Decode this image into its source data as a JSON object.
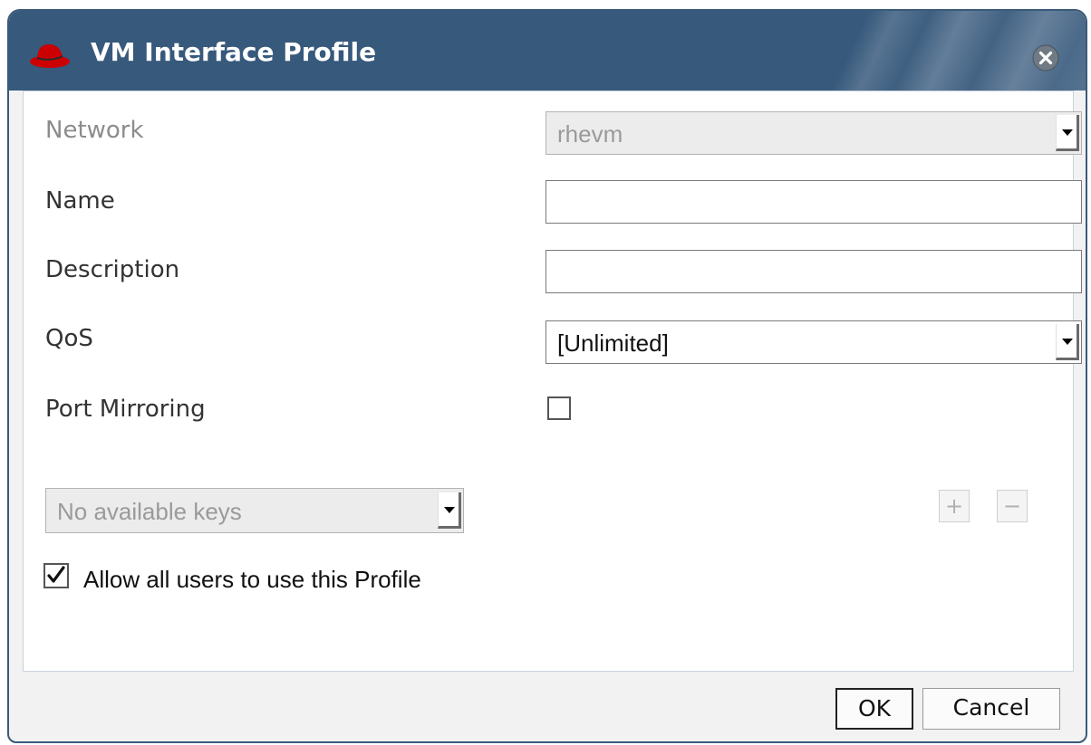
{
  "dialog": {
    "title": "VM Interface Profile",
    "title_bar_color": "#37597c",
    "logo_color": "#cc0000"
  },
  "form": {
    "network": {
      "label": "Network",
      "value": "rhevm",
      "disabled": true
    },
    "name": {
      "label": "Name",
      "value": ""
    },
    "description": {
      "label": "Description",
      "value": ""
    },
    "qos": {
      "label": "QoS",
      "value": "[Unlimited]"
    },
    "port_mirroring": {
      "label": "Port Mirroring",
      "checked": false
    }
  },
  "custom_properties": {
    "keys_value": "No available keys",
    "add_label": "+",
    "remove_label": "−"
  },
  "allow_all": {
    "label": "Allow all users to use this Profile",
    "checked": true
  },
  "footer": {
    "ok_label": "OK",
    "cancel_label": "Cancel"
  }
}
